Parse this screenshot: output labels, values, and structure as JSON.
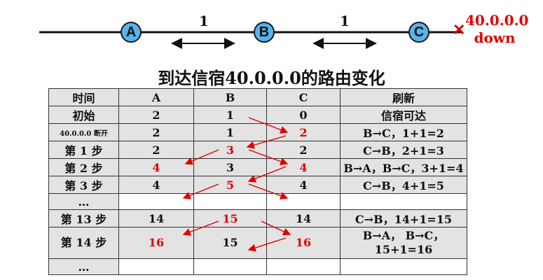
{
  "network": {
    "nodes": [
      "A",
      "B",
      "C"
    ],
    "distances": [
      "1",
      "1"
    ],
    "target_network": "40.0.0.0",
    "status": "down",
    "failure_icon": "x-mark-icon"
  },
  "title": "到达信宿40.0.0.0的路由变化",
  "table": {
    "headers": [
      "时间",
      "A",
      "B",
      "C",
      "刷新"
    ],
    "rows": [
      {
        "time": "初始",
        "a": "2",
        "b": "1",
        "c": "0",
        "update": "信宿可达",
        "red": []
      },
      {
        "time": "40.0.0.0 断开",
        "a": "2",
        "b": "1",
        "c": "2",
        "update": "B→C，1+1=2",
        "red": [
          "c"
        ]
      },
      {
        "time": "第 1 步",
        "a": "2",
        "b": "3",
        "c": "2",
        "update": "C→B，2+1=3",
        "red": [
          "b"
        ]
      },
      {
        "time": "第 2 步",
        "a": "4",
        "b": "3",
        "c": "4",
        "update": "B→A，B→C，3+1=4",
        "red": [
          "a",
          "c"
        ]
      },
      {
        "time": "第 3 步",
        "a": "4",
        "b": "5",
        "c": "4",
        "update": "C→B，4+1=5",
        "red": [
          "b"
        ]
      },
      {
        "time": "…",
        "a": "",
        "b": "",
        "c": "",
        "update": "",
        "red": []
      },
      {
        "time": "第 13 步",
        "a": "14",
        "b": "15",
        "c": "14",
        "update": "C→B，14+1=15",
        "red": [
          "b"
        ]
      },
      {
        "time": "第 14 步",
        "a": "16",
        "b": "15",
        "c": "16",
        "update": "B→A， B→C，\n15+1=16",
        "red": [
          "a",
          "c"
        ]
      },
      {
        "time": "…",
        "a": "",
        "b": "",
        "c": "",
        "update": "",
        "red": []
      }
    ]
  },
  "colors": {
    "node_fill": "#56b4e9",
    "highlight": "#e00000",
    "cell_bg": "#e3e3e3"
  }
}
